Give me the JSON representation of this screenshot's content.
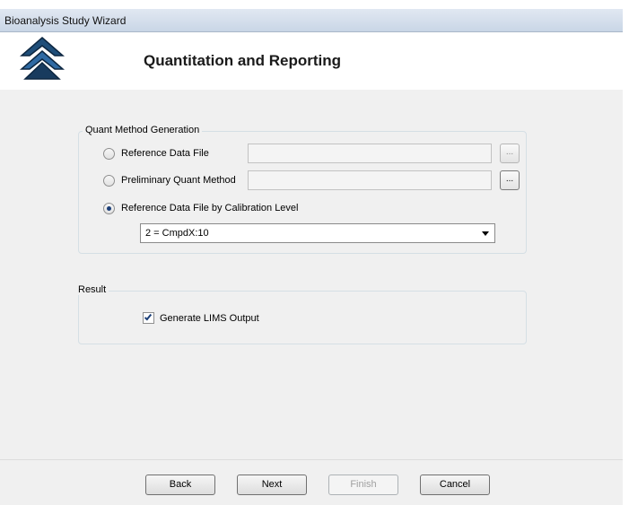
{
  "window": {
    "title": "Bioanalysis Study Wizard"
  },
  "header": {
    "title": "Quantitation and Reporting",
    "logo_icon": "double-chevron-up-icon"
  },
  "quant_group": {
    "label": "Quant Method Generation",
    "options": [
      {
        "label": "Reference Data File",
        "checked": false
      },
      {
        "label": "Preliminary Quant Method",
        "checked": false
      },
      {
        "label": "Reference Data File by Calibration Level",
        "checked": true
      }
    ],
    "browse_label": "...",
    "calibration_level": {
      "selected": "2 = CmpdX:10"
    }
  },
  "result_group": {
    "label": "Result",
    "generate_lims": {
      "label": "Generate LIMS Output",
      "checked": true
    }
  },
  "footer": {
    "back": "Back",
    "next": "Next",
    "finish": "Finish",
    "cancel": "Cancel"
  }
}
